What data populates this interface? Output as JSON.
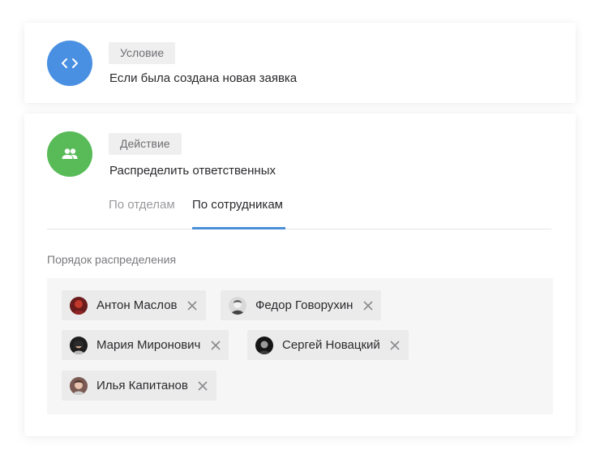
{
  "condition": {
    "tag_label": "Условие",
    "description": "Если была создана новая заявка",
    "icon": "code-icon",
    "icon_color": "#4a90e2"
  },
  "action": {
    "tag_label": "Действие",
    "description": "Распределить ответственных",
    "icon": "people-icon",
    "icon_color": "#58bb58",
    "tabs": [
      {
        "label": "По отделам",
        "active": false
      },
      {
        "label": "По сотрудникам",
        "active": true
      }
    ],
    "accent_color": "#4a8fd8",
    "order_label": "Порядок распределения",
    "employees": [
      {
        "name": "Антон Маслов",
        "avatar": "avatar-red"
      },
      {
        "name": "Федор Говорухин",
        "avatar": "avatar-light"
      },
      {
        "name": "Мария Миронович",
        "avatar": "avatar-dark"
      },
      {
        "name": "Сергей Новацкий",
        "avatar": "avatar-dark"
      },
      {
        "name": "Илья Капитанов",
        "avatar": "avatar-face"
      }
    ]
  }
}
